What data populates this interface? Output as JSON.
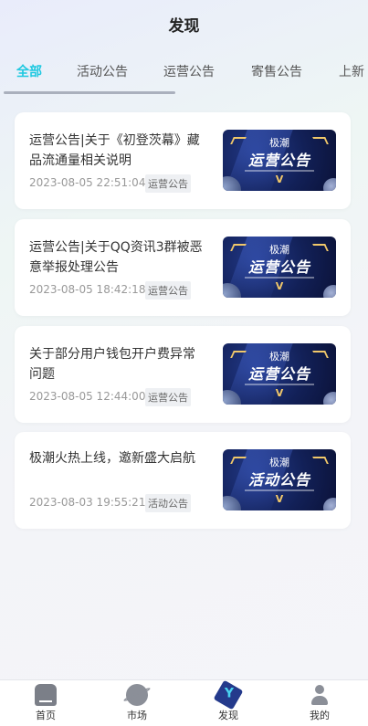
{
  "header": {
    "title": "发现"
  },
  "tabs": [
    {
      "label": "全部",
      "active": true
    },
    {
      "label": "活动公告",
      "active": false
    },
    {
      "label": "运营公告",
      "active": false
    },
    {
      "label": "寄售公告",
      "active": false
    },
    {
      "label": "上新",
      "active": false
    }
  ],
  "colors": {
    "accent": "#1ec8e0",
    "thumb_bg": "#122057",
    "thumb_gold": "#f1c86a"
  },
  "thumbnail": {
    "brand": "极潮",
    "mark": "V"
  },
  "announcements": [
    {
      "title": "运营公告|关于《初登茨幕》藏品流通量相关说明",
      "date": "2023-08-05 22:51:04",
      "tag": "运营公告",
      "thumb_label": "运营公告"
    },
    {
      "title": "运营公告|关于QQ资讯3群被恶意举报处理公告",
      "date": "2023-08-05 18:42:18",
      "tag": "运营公告",
      "thumb_label": "运营公告"
    },
    {
      "title": "关于部分用户钱包开户费异常问题",
      "date": "2023-08-05 12:44:00",
      "tag": "运营公告",
      "thumb_label": "运营公告"
    },
    {
      "title": "极潮火热上线，邀新盛大启航",
      "date": "2023-08-03 19:55:21",
      "tag": "活动公告",
      "thumb_label": "活动公告"
    }
  ],
  "bottom_nav": [
    {
      "label": "首页",
      "icon": "home-icon"
    },
    {
      "label": "市场",
      "icon": "planet-icon"
    },
    {
      "label": "发现",
      "icon": "discover-icon",
      "active": true
    },
    {
      "label": "我的",
      "icon": "user-icon"
    }
  ]
}
